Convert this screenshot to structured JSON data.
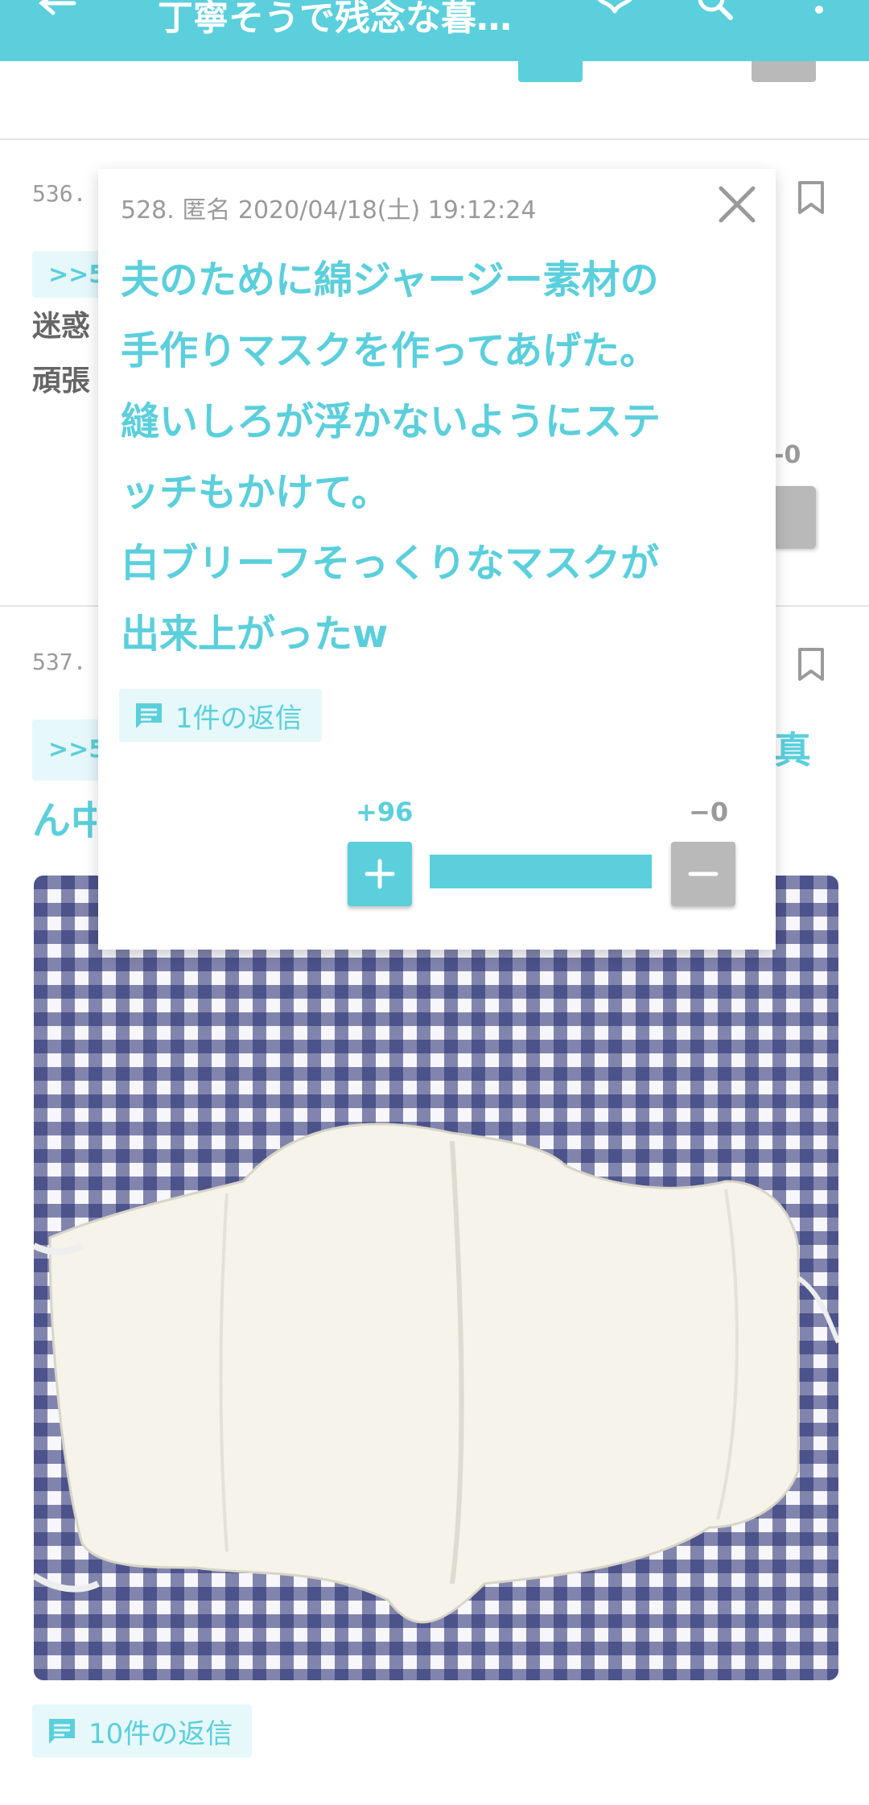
{
  "appbar": {
    "title": "丁寧そうで残念な暮…",
    "background": "#5bcfdc"
  },
  "posts": [
    {
      "number": "536.",
      "anchor": ">>53",
      "body_lines": [
        "迷惑",
        "頑張"
      ],
      "minus_count": "-0"
    },
    {
      "number": "537.",
      "anchor": ">>5",
      "body_line": "ん中",
      "trailing_char": "真",
      "replies_label": "10件の返信"
    }
  ],
  "popup": {
    "meta": "528. 匿名  2020/04/18(土)  19:12:24",
    "text_lines": [
      "夫のために綿ジャージー素材の",
      "手作りマスクを作ってあげた。",
      "縫いしろが浮かないようにステ",
      "ッチもかけて。",
      "白ブリーフそっくりなマスクが",
      "出来上がったw"
    ],
    "replies_label": "1件の返信",
    "plus_count": "+96",
    "minus_count": "−0",
    "vote_ratio": 1.0
  },
  "colors": {
    "accent": "#5bcfdc",
    "neutral_button": "#b9b9b9",
    "chip_background": "#e6f8fa"
  },
  "icons": {
    "back": "arrow-left-icon",
    "favorite": "heart-outline-icon",
    "search": "search-icon",
    "more": "more-vert-icon",
    "close": "close-icon",
    "bookmark": "bookmark-outline-icon",
    "replies": "chat-icon"
  }
}
